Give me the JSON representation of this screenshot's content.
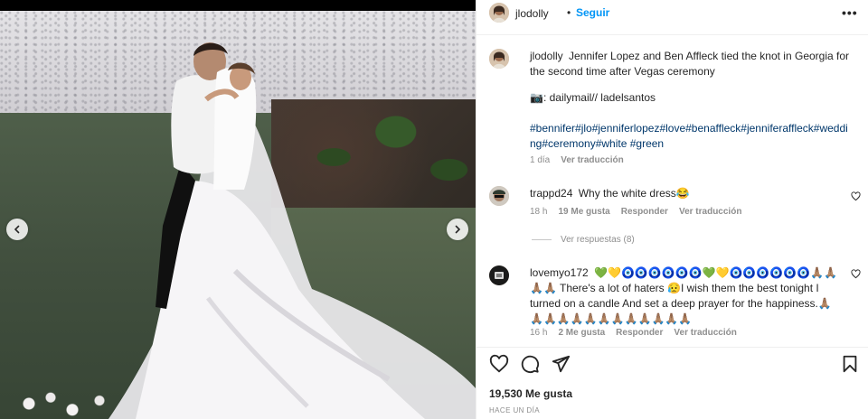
{
  "post": {
    "author": "jlodolly",
    "separator": "•",
    "follow_label": "Seguir",
    "more_label": "•••",
    "caption": "Jennifer Lopez and Ben Affleck tied the knot in Georgia for the second time after Vegas ceremony",
    "credit": "📷: dailymail// ladelsantos",
    "hashtags": "#bennifer#jlo#jenniferlopez#love#benaffleck#jenniferaffleck#wedding#ceremony#white #green",
    "caption_time": "1 día",
    "caption_translate": "Ver traducción",
    "likes": "19,530 Me gusta",
    "posted_ago": "HACE UN DÍA"
  },
  "comments": [
    {
      "username": "trappd24",
      "text": "Why the white dress😂",
      "time": "18 h",
      "likes": "19 Me gusta",
      "reply": "Responder",
      "translate": "Ver traducción",
      "view_replies": "Ver respuestas (8)"
    },
    {
      "username": "lovemyo172",
      "text": "💚💛🧿🧿🧿🧿🧿🧿💚💛🧿🧿🧿🧿🧿🧿🙏🏽🙏🏽🙏🏽🙏🏽 There's a lot of haters 😥I wish them the best tonight I turned on a candle And set a deep prayer for the happiness.🙏🏽🙏🏽🙏🏽🙏🏽🙏🏽🙏🏽🙏🏽🙏🏽🙏🏽🙏🏽🙏🏽🙏🏽🙏🏽",
      "time": "16 h",
      "likes": "2 Me gusta",
      "reply": "Responder",
      "translate": "Ver traducción"
    }
  ],
  "colors": {
    "accent": "#0095f6",
    "hashtag": "#00376b",
    "muted": "#8e8e8e"
  },
  "icons": {
    "prev": "chevron-left-icon",
    "next": "chevron-right-icon",
    "like": "heart-icon",
    "comment": "comment-icon",
    "share": "paper-plane-icon",
    "save": "bookmark-icon"
  }
}
